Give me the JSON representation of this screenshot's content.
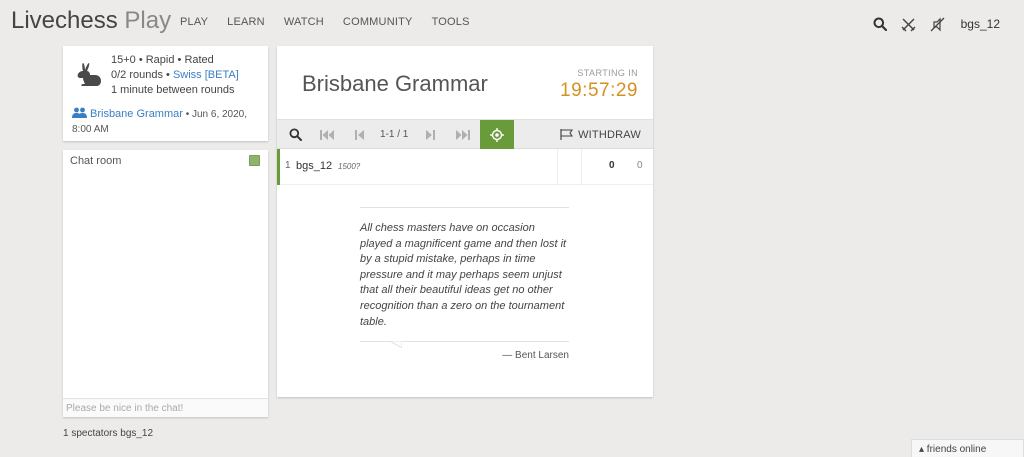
{
  "header": {
    "brand_main": "Livechess",
    "brand_suffix": " Play",
    "nav": [
      "PLAY",
      "LEARN",
      "WATCH",
      "COMMUNITY",
      "TOOLS"
    ],
    "username": "bgs_12",
    "icons": [
      "search-icon",
      "swords-icon",
      "mute-icon"
    ]
  },
  "tournament_info": {
    "setup": "15+0 • Rapid • Rated",
    "rounds": "0/2 rounds • ",
    "system_link": "Swiss [BETA]",
    "between_rounds": "1 minute between rounds",
    "club_link": "Brisbane Grammar",
    "created": " • Jun 6, 2020, 8:00 AM"
  },
  "chat": {
    "title": "Chat room",
    "placeholder": "Please be nice in the chat!"
  },
  "spectators": "1 spectators bgs_12",
  "main": {
    "title": "Brisbane Grammar",
    "starting_label": "STARTING IN",
    "countdown": "19:57:29",
    "pager": "1-1 / 1",
    "withdraw_label": "WITHDRAW"
  },
  "standings": [
    {
      "rank": "1",
      "player": "bgs_12",
      "rating": "1500?",
      "score": "0",
      "performance": "0"
    }
  ],
  "quote": {
    "text": "All chess masters have on occasion played a magnificent game and then lost it by a stupid mistake, perhaps in time pressure and it may perhaps seem unjust that all their beautiful ideas get no other recognition than a zero on the tournament table.",
    "author": "— Bent Larsen"
  },
  "friends_bar": "▴ friends online",
  "colors": {
    "accent_green": "#6a9b3a",
    "clock_orange": "#d59120",
    "link_blue": "#3a7fc4"
  }
}
